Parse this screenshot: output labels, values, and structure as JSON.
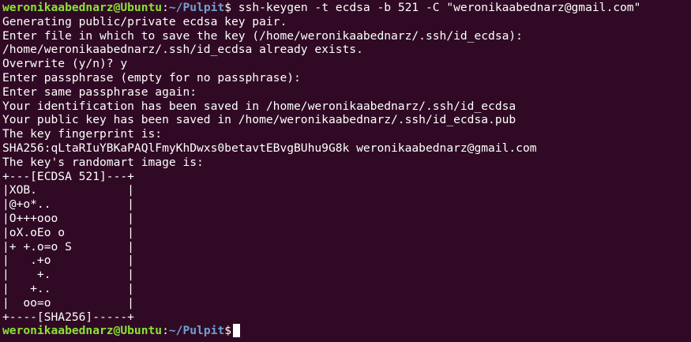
{
  "prompt": {
    "user_host": "weronikaabednarz@Ubuntu",
    "separator": ":",
    "path": "~/Pulpit",
    "symbol": "$"
  },
  "command": " ssh-keygen -t ecdsa -b 521 -C \"weronikaabednarz@gmail.com\"",
  "output": [
    "Generating public/private ecdsa key pair.",
    "Enter file in which to save the key (/home/weronikaabednarz/.ssh/id_ecdsa):",
    "/home/weronikaabednarz/.ssh/id_ecdsa already exists.",
    "Overwrite (y/n)? y",
    "Enter passphrase (empty for no passphrase):",
    "Enter same passphrase again:",
    "Your identification has been saved in /home/weronikaabednarz/.ssh/id_ecdsa",
    "Your public key has been saved in /home/weronikaabednarz/.ssh/id_ecdsa.pub",
    "The key fingerprint is:",
    "SHA256:qLtaRIuYBKaPAQlFmyKhDwxs0betavtEBvgBUhu9G8k weronikaabednarz@gmail.com",
    "The key's randomart image is:",
    "+---[ECDSA 521]---+",
    "|XOB.             |",
    "|@+o*..           |",
    "|O+++ooo          |",
    "|oX.oEo o         |",
    "|+ +.o=o S        |",
    "|   .+o           |",
    "|    +.           |",
    "|   +..           |",
    "|  oo=o           |",
    "+----[SHA256]-----+"
  ]
}
